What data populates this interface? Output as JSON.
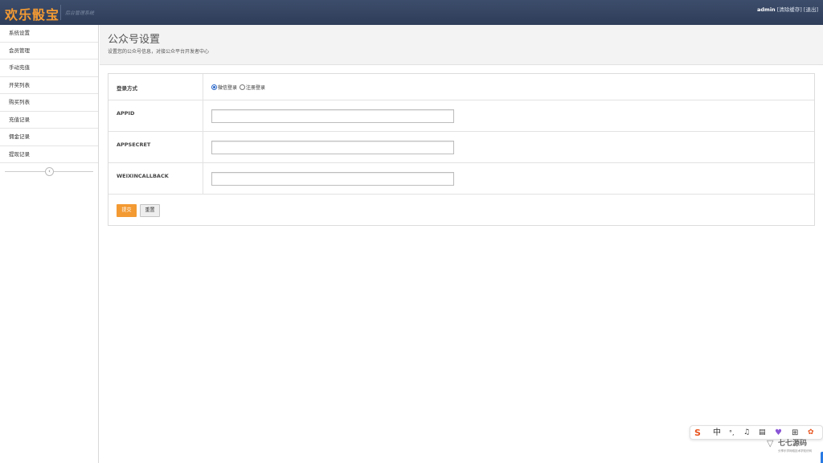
{
  "header": {
    "logo": "欢乐骰宝",
    "subtitle": "后台管理系统",
    "user": "admin",
    "clear_cache": "[清除缓存]",
    "logout": "[退出]",
    "bg_color": "#34445f",
    "brand_color": "#f39a33"
  },
  "sidebar": {
    "items": [
      {
        "label": "系统设置"
      },
      {
        "label": "会员管理"
      },
      {
        "label": "手动充值"
      },
      {
        "label": "开奖列表"
      },
      {
        "label": "购买列表"
      },
      {
        "label": "充值记录"
      },
      {
        "label": "佣金记录"
      },
      {
        "label": "提现记录"
      }
    ],
    "collapse_icon": "chevron-left-icon"
  },
  "main": {
    "title": "公众号设置",
    "description": "设置您的公众号信息，对接公众平台开发者中心",
    "form": {
      "login_label": "登录方式",
      "login_options": [
        {
          "label": "微信登录",
          "selected": true
        },
        {
          "label": "注册登录",
          "selected": false
        }
      ],
      "fields": [
        {
          "label": "APPID",
          "value": "",
          "placeholder": ""
        },
        {
          "label": "APPSECRET",
          "value": "",
          "placeholder": ""
        },
        {
          "label": "WEIXINCALLBACK",
          "value": "",
          "placeholder": ""
        }
      ],
      "submit_label": "提交",
      "reset_label": "重置"
    }
  },
  "watermark": {
    "name": "七七源码",
    "tagline": "分享乐学网络技术学知识网"
  },
  "ime_toolbar": {
    "mode": "中"
  }
}
